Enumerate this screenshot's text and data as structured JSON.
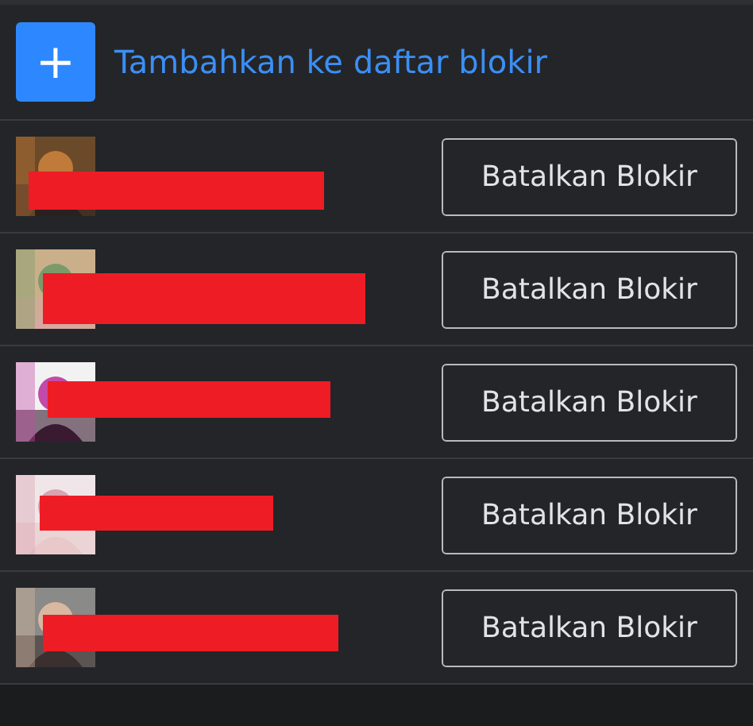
{
  "add_button": {
    "icon": "+",
    "label": "Tambahkan ke daftar blokir"
  },
  "blocked_users": [
    {
      "redacted": true,
      "action": "Batalkan Blokir"
    },
    {
      "redacted": true,
      "action": "Batalkan Blokir"
    },
    {
      "redacted": true,
      "action": "Batalkan Blokir"
    },
    {
      "redacted": true,
      "action": "Batalkan Blokir"
    },
    {
      "redacted": true,
      "action": "Batalkan Blokir"
    }
  ]
}
